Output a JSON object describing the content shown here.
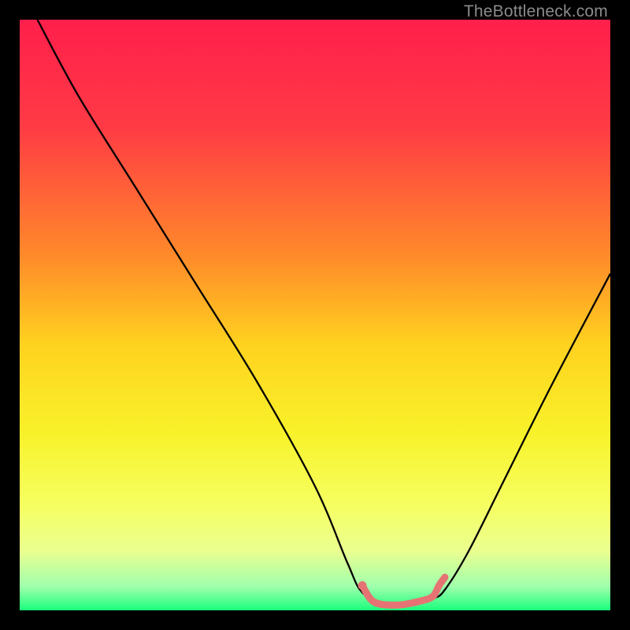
{
  "attribution": "TheBottleneck.com",
  "chart_data": {
    "type": "line",
    "title": "",
    "xlabel": "",
    "ylabel": "",
    "xlim": [
      0,
      100
    ],
    "ylim": [
      0,
      100
    ],
    "gradient_stops": [
      {
        "offset": 0,
        "color": "#ff1f4b"
      },
      {
        "offset": 18,
        "color": "#ff3a45"
      },
      {
        "offset": 40,
        "color": "#ff8a2a"
      },
      {
        "offset": 55,
        "color": "#ffd21f"
      },
      {
        "offset": 70,
        "color": "#f8f22a"
      },
      {
        "offset": 82,
        "color": "#f6ff60"
      },
      {
        "offset": 90,
        "color": "#eaff90"
      },
      {
        "offset": 96,
        "color": "#9fffac"
      },
      {
        "offset": 100,
        "color": "#1bff7d"
      }
    ],
    "series": [
      {
        "name": "bottleneck-curve",
        "color": "#000000",
        "width": 2.3,
        "x": [
          3,
          10,
          20,
          30,
          40,
          50,
          55.5,
          58,
          62,
          66,
          70,
          72,
          76,
          82,
          90,
          100
        ],
        "y": [
          100,
          87,
          71,
          55,
          39,
          21,
          8,
          3,
          1,
          1,
          2,
          3.5,
          10,
          22,
          38,
          57
        ]
      },
      {
        "name": "accent-marker",
        "color": "#e57373",
        "width": 9,
        "linecap": "round",
        "x": [
          58,
          60,
          64,
          68,
          70,
          71,
          72
        ],
        "y": [
          4.2,
          1.4,
          0.9,
          1.6,
          2.4,
          4.2,
          5.6
        ]
      },
      {
        "name": "accent-start-dot",
        "type": "dot",
        "color": "#e57373",
        "r": 5.5,
        "cx": 58,
        "cy": 4.2
      }
    ]
  }
}
